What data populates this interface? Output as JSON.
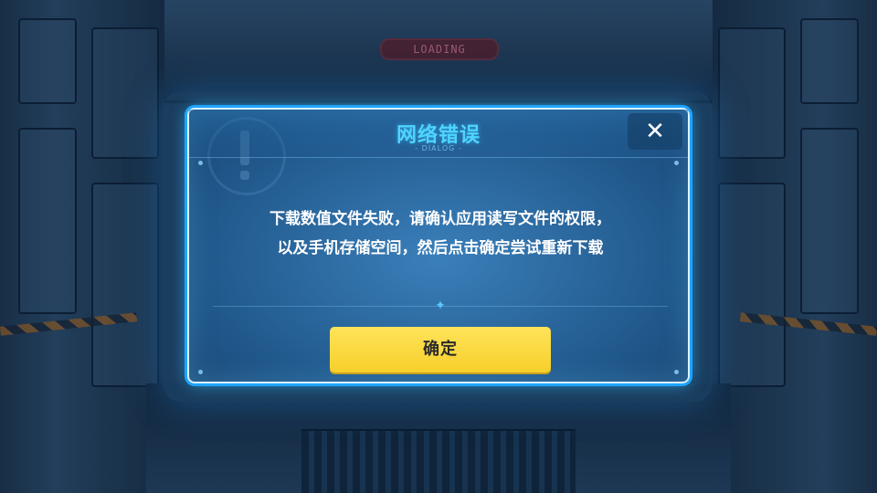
{
  "background": {
    "sign_text": "LOADING"
  },
  "dialog": {
    "title": "网络错误",
    "subtitle": "- DIALOG -",
    "close_label": "✕",
    "message_lines": [
      "下载数值文件失败，请确认应用读写文件的权限，",
      "以及手机存储空间，然后点击确定尝试重新下载"
    ],
    "divider_glyph": "✦",
    "confirm_label": "确定"
  },
  "colors": {
    "title": "#4fd4ff",
    "confirm_button": "#f6cf2a",
    "dialog_border": "#1ea5ff"
  },
  "icons": {
    "close": "close-icon",
    "watermark": "exclamation-icon"
  }
}
